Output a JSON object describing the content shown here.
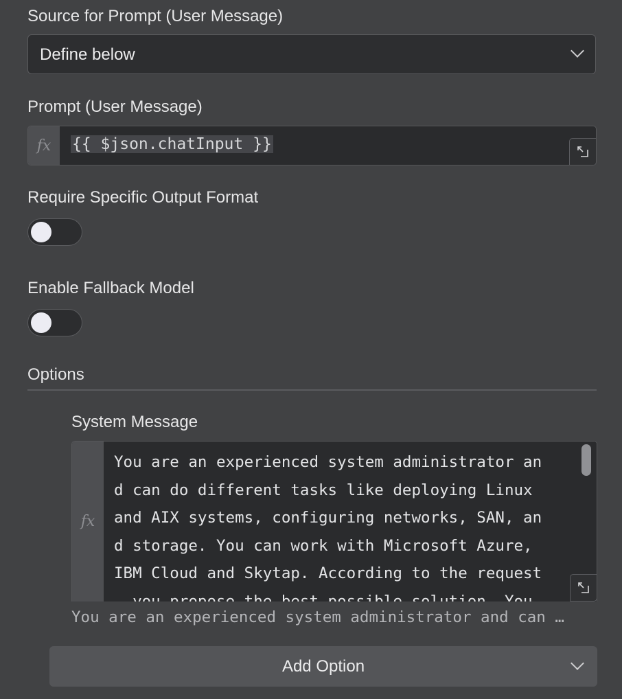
{
  "source_prompt": {
    "label": "Source for Prompt (User Message)",
    "selected": "Define below",
    "dropdown_icon": "chevron-down-icon"
  },
  "prompt": {
    "label": "Prompt (User Message)",
    "fx": "fx",
    "value": "{{ $json.chatInput }}",
    "expand_icon": "expand-icon"
  },
  "require_output_format": {
    "label": "Require Specific Output Format",
    "enabled": false
  },
  "fallback_model": {
    "label": "Enable Fallback Model",
    "enabled": false
  },
  "options": {
    "heading": "Options",
    "system_message": {
      "label": "System Message",
      "fx": "fx",
      "lines": [
        "You are an experienced system administrator an",
        "d can do different tasks like deploying Linux",
        "and AIX systems, configuring networks, SAN, an",
        "d storage. You can work with Microsoft Azure,",
        "IBM Cloud and Skytap. According to the request",
        ", you propose the best possible solution. You"
      ],
      "preview": "You are an experienced system administrator and can …"
    },
    "add_option_label": "Add Option"
  },
  "colors": {
    "background": "#414244",
    "input_bg": "#2d2e30",
    "border": "#5a5b5e"
  }
}
